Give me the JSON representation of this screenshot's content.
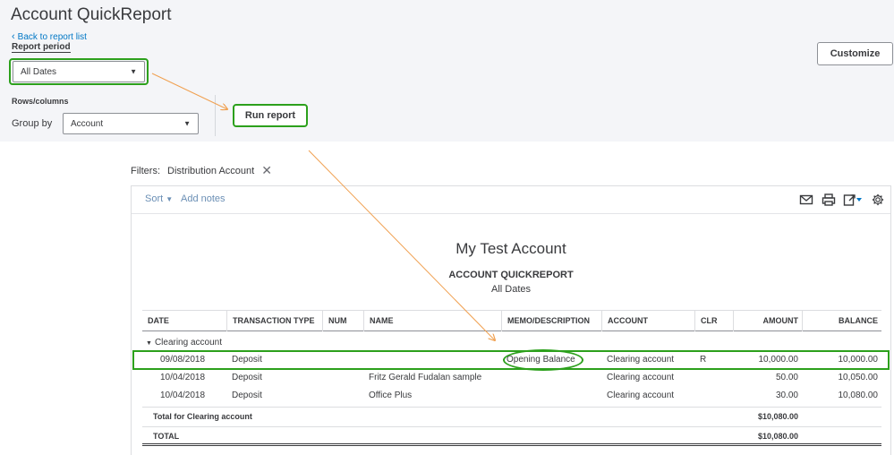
{
  "header": {
    "title": "Account QuickReport",
    "back_link": "Back to report list",
    "report_period_label": "Report period",
    "report_period_value": "All Dates",
    "rows_columns_label": "Rows/columns",
    "group_by_label": "Group by",
    "group_by_value": "Account",
    "run_report_label": "Run report",
    "customize_label": "Customize"
  },
  "filters": {
    "label": "Filters:",
    "chip": "Distribution Account"
  },
  "toolbar": {
    "sort_label": "Sort",
    "add_notes_label": "Add notes",
    "icons": [
      "mail-icon",
      "print-icon",
      "export-icon",
      "settings-icon"
    ]
  },
  "report": {
    "company": "My Test Account",
    "title": "ACCOUNT QUICKREPORT",
    "period": "All Dates",
    "columns": [
      "DATE",
      "TRANSACTION TYPE",
      "NUM",
      "NAME",
      "MEMO/DESCRIPTION",
      "ACCOUNT",
      "CLR",
      "AMOUNT",
      "BALANCE"
    ],
    "group": "Clearing account",
    "rows": [
      {
        "date": "09/08/2018",
        "type": "Deposit",
        "num": "",
        "name": "",
        "memo": "Opening Balance",
        "account": "Clearing account",
        "clr": "R",
        "amount": "10,000.00",
        "balance": "10,000.00"
      },
      {
        "date": "10/04/2018",
        "type": "Deposit",
        "num": "",
        "name": "Fritz Gerald Fudalan sample",
        "memo": "",
        "account": "Clearing account",
        "clr": "",
        "amount": "50.00",
        "balance": "10,050.00"
      },
      {
        "date": "10/04/2018",
        "type": "Deposit",
        "num": "",
        "name": "Office Plus",
        "memo": "",
        "account": "Clearing account",
        "clr": "",
        "amount": "30.00",
        "balance": "10,080.00"
      }
    ],
    "group_total_label": "Total for Clearing account",
    "group_total_amount": "$10,080.00",
    "total_label": "TOTAL",
    "total_amount": "$10,080.00"
  },
  "colors": {
    "highlight": "#2ca01c",
    "arrow": "#f0a050",
    "link": "#0077c5"
  }
}
